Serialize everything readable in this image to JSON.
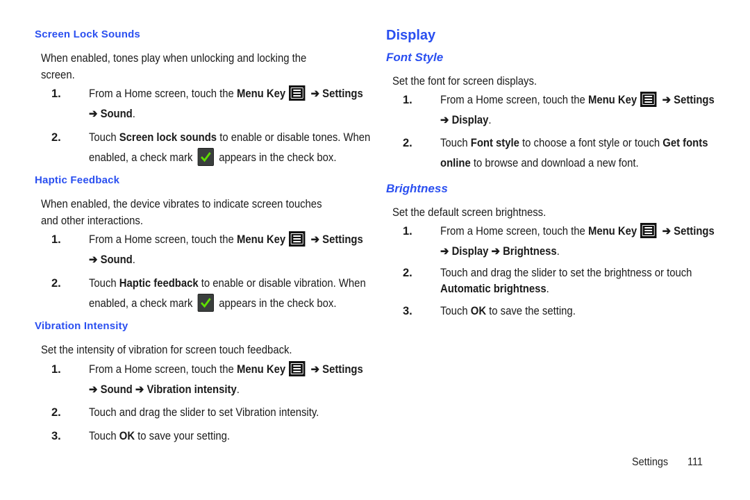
{
  "left": {
    "screen_lock": {
      "heading": "Screen Lock Sounds",
      "intro_line1": "When enabled, tones play when unlocking and locking the",
      "intro_line2": "screen.",
      "step1": {
        "num": "1.",
        "pre": "From a Home screen, touch the ",
        "key": "Menu Key",
        "after_icon": " ➔ Settings",
        "line2": "➔ Sound",
        "end": "."
      },
      "step2": {
        "num": "2.",
        "pre": "Touch ",
        "bold": "Screen lock sounds",
        "post": " to enable or disable tones. When",
        "line2_pre": "enabled, a check mark",
        "line2_post": "appears in the check box."
      }
    },
    "haptic": {
      "heading": "Haptic Feedback",
      "intro_line1": "When enabled, the device vibrates to indicate screen touches",
      "intro_line2": "and other interactions.",
      "step1": {
        "num": "1.",
        "pre": "From a Home screen, touch the ",
        "key": "Menu Key",
        "after_icon": " ➔ Settings",
        "line2": "➔ Sound",
        "end": "."
      },
      "step2": {
        "num": "2.",
        "pre": "Touch ",
        "bold": "Haptic feedback",
        "post": " to enable or disable vibration. When",
        "line2_pre": "enabled, a check mark",
        "line2_post": "appears in the check box."
      }
    },
    "vibration": {
      "heading": "Vibration Intensity",
      "intro": "Set the intensity of vibration for screen touch feedback.",
      "step1": {
        "num": "1.",
        "pre": "From a Home screen, touch the ",
        "key": "Menu Key",
        "after_icon": " ➔ Settings",
        "line2": "➔ Sound ➔ Vibration intensity",
        "end": "."
      },
      "step2": {
        "num": "2.",
        "text": "Touch and drag the slider to set Vibration intensity."
      },
      "step3": {
        "num": "3.",
        "pre": "Touch ",
        "bold": "OK",
        "post": " to save your setting."
      }
    }
  },
  "right": {
    "title": "Display",
    "font_style": {
      "heading": "Font Style",
      "intro": "Set the font for screen displays.",
      "step1": {
        "num": "1.",
        "pre": "From a Home screen, touch the ",
        "key": "Menu Key",
        "after_icon": " ➔ Settings",
        "line2": "➔ Display",
        "end": "."
      },
      "step2": {
        "num": "2.",
        "pre": "Touch ",
        "bold": "Font style",
        "mid": " to choose a font style or touch ",
        "bold2": "Get fonts",
        "line2_bold": "online",
        "line2_post": " to browse and download a new font."
      }
    },
    "brightness": {
      "heading": "Brightness",
      "intro": "Set the default screen brightness.",
      "step1": {
        "num": "1.",
        "pre": "From a Home screen, touch the ",
        "key": "Menu Key",
        "after_icon": " ➔ Settings",
        "line2": "➔ Display ➔ Brightness",
        "end": "."
      },
      "step2": {
        "num": "2.",
        "text": "Touch and drag the slider to set the brightness or touch",
        "line2_bold": "Automatic brightness",
        "end": "."
      },
      "step3": {
        "num": "3.",
        "pre": "Touch ",
        "bold": "OK",
        "post": " to save the setting."
      }
    }
  },
  "footer": {
    "section": "Settings",
    "page": "111"
  },
  "colors": {
    "heading": "#2a4ff0",
    "check": "#5fe000"
  },
  "icons": {
    "menu_key": "menu-key-icon",
    "checkmark": "checkbox-checked-icon"
  }
}
